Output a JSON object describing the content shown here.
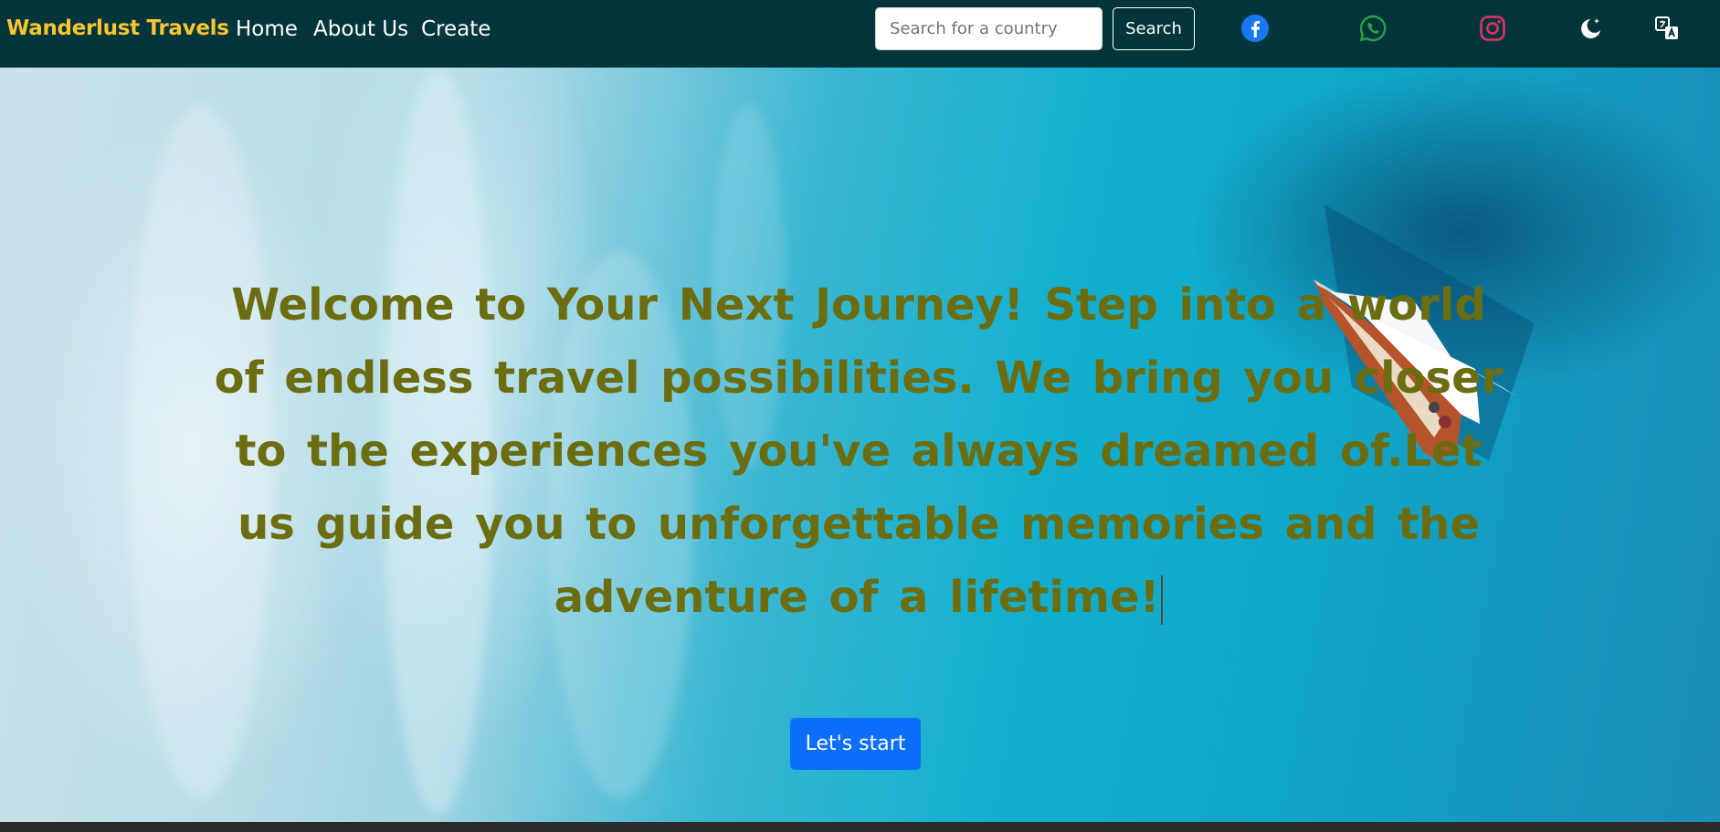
{
  "navbar": {
    "brand": "Wanderlust Travels",
    "links": [
      "Home",
      "About Us",
      "Create"
    ],
    "search": {
      "placeholder": "Search for a country",
      "value": "",
      "button_label": "Search"
    },
    "icons": [
      "facebook-icon",
      "whatsapp-icon",
      "instagram-icon",
      "dark-mode-icon",
      "translate-icon"
    ]
  },
  "hero": {
    "text": "Welcome to Your Next Journey! Step into a world of endless travel possibilities. We bring you closer to the experiences you've always dreamed of.Let us guide you to unforgettable memories and the adventure of a lifetime!",
    "cta_label": "Let's start"
  },
  "colors": {
    "navbar_bg": "#04353a",
    "brand": "#f7c530",
    "hero_text": "#6b6d10",
    "cta": "#0d6efd",
    "facebook": "#1877f2",
    "whatsapp": "#25a244",
    "instagram": "#e1306c"
  }
}
